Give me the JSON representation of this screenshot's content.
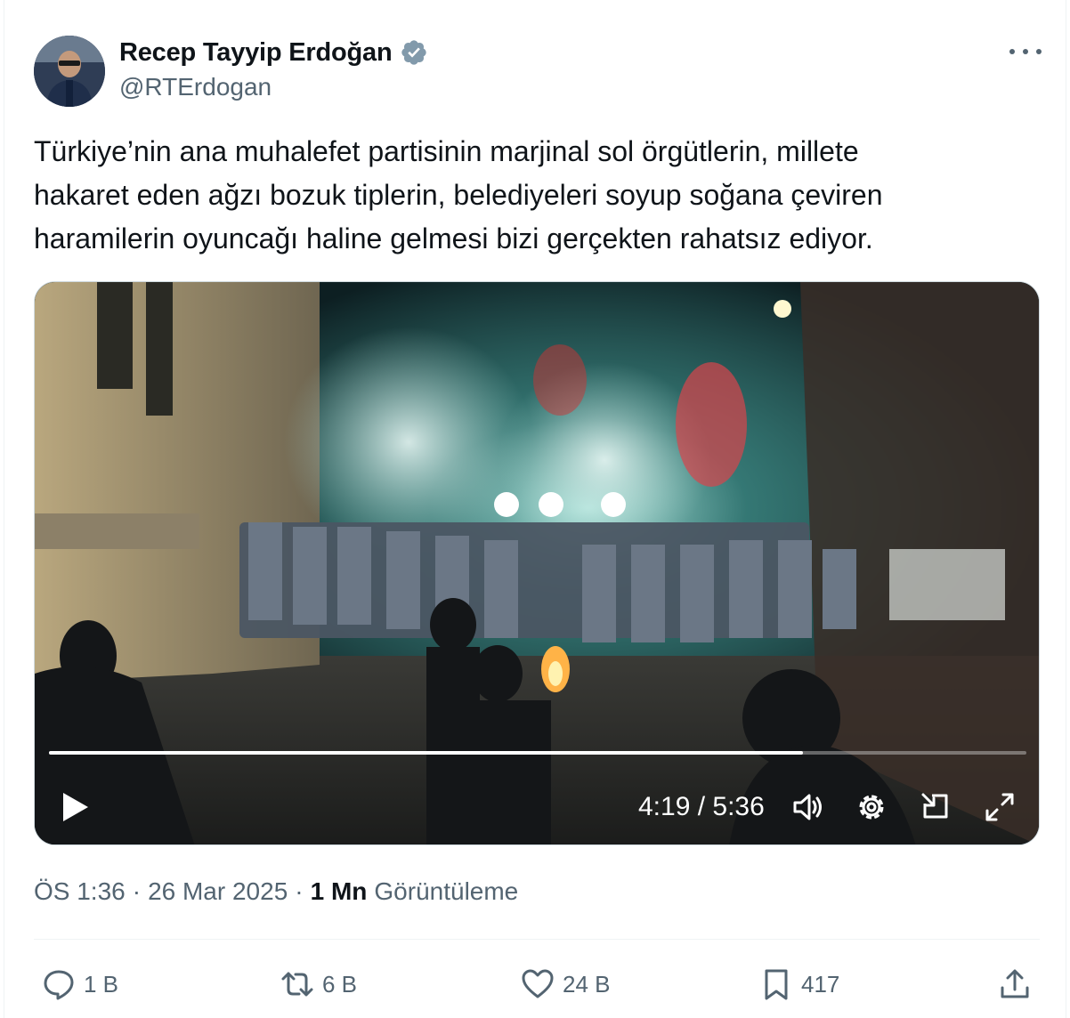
{
  "author": {
    "name": "Recep Tayyip Erdoğan",
    "handle": "@RTErdogan",
    "verified": true,
    "avatar_icon": "profile-photo"
  },
  "tweet": {
    "text": "Türkiye’nin ana muhalefet partisinin marjinal sol örgütlerin, millete\nhakaret eden ağzı bozuk tiplerin, belediyeleri soyup soğana çeviren\nharamilerin oyuncağı haline gelmesi bizi gerçekten rahatsız ediyor."
  },
  "video": {
    "current_time": "4:19",
    "duration": "5:36",
    "time_display": "4:19 / 5:36",
    "progress_fraction": 0.771,
    "controls": [
      "play-icon",
      "volume-icon",
      "settings-icon",
      "pip-icon",
      "fullscreen-icon"
    ]
  },
  "meta": {
    "time": "ÖS 1:36",
    "date": "26 Mar 2025",
    "separator": "·",
    "views_count": "1 Mn",
    "views_label": "Görüntüleme"
  },
  "actions": {
    "reply": "1 B",
    "retweet": "6 B",
    "like": "24 B",
    "bookmark": "417"
  },
  "colors": {
    "text": "#0f1419",
    "secondary": "#536471",
    "verified": "#829aab",
    "divider": "#eff3f4"
  }
}
